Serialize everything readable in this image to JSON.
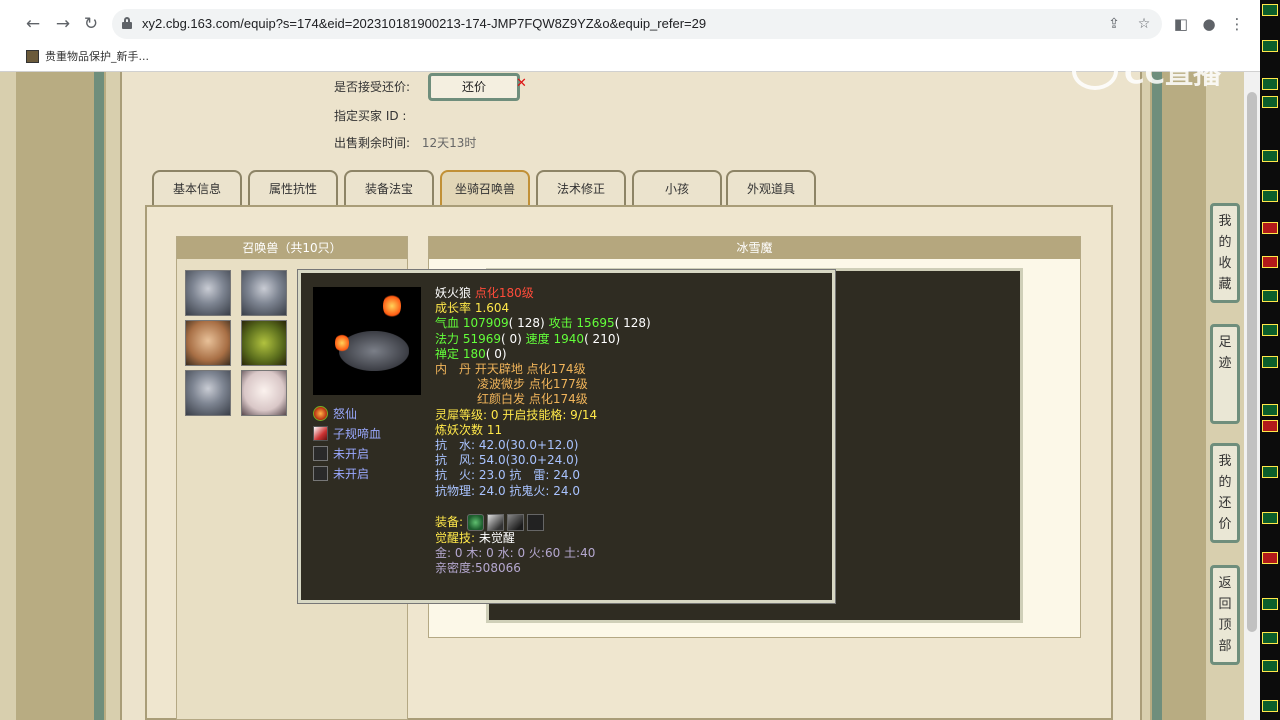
{
  "browser": {
    "url": "xy2.cbg.163.com/equip?s=174&eid=202310181900213-174-JMP7FQW8Z9YZ&o&equip_refer=29",
    "bookmark_label": "贵重物品保护_新手..."
  },
  "watermark": "CC直播",
  "form": {
    "accept_counter_label": "是否接受还价:",
    "counter_button": "还价",
    "buyer_id_label": "指定买家 ID :",
    "time_left_label": "出售剩余时间:",
    "time_left_value": "12天13时"
  },
  "tabs": [
    "基本信息",
    "属性抗性",
    "装备法宝",
    "坐骑召唤兽",
    "法术修正",
    "小孩",
    "外观道具"
  ],
  "pet_list": {
    "title": "召唤兽（共10只）"
  },
  "detail": {
    "title": "冰雪魔"
  },
  "tooltip": {
    "name": "妖火狼",
    "level": "点化180级",
    "growth": "成长率 1.604",
    "qixue_label": "气血",
    "qixue_value": "107909",
    "qixue_extra": "( 128)",
    "gongji_label": "攻击",
    "gongji_value": "15695",
    "gongji_extra": "( 128)",
    "fali_label": "法力",
    "fali_value": "51969",
    "fali_extra": "( 0)",
    "sudu_label": "速度",
    "sudu_value": "1940",
    "sudu_extra": "( 210)",
    "chanding_label": "禅定",
    "chanding_value": "180",
    "chanding_extra": "( 0)",
    "neidan_label": "内　丹",
    "neidan": [
      "开天辟地 点化174级",
      "凌波微步 点化177级",
      "红颜白发 点化174级"
    ],
    "lingxi_label": "灵犀等级:",
    "lingxi_value": "0 开启技能格: 9/14",
    "lianyao": "炼妖次数 11",
    "resist_water": "抗　水: 42.0(30.0+12.0)",
    "resist_wind": "抗　风: 54.0(30.0+24.0)",
    "resist_fire_thunder": "抗　火: 23.0 抗　雷: 24.0",
    "resist_phys_ghost": "抗物理: 24.0 抗鬼火: 24.0",
    "equip_label": "装备:",
    "awaken_label": "觉醒技:",
    "awaken_value": "未觉醒",
    "elements": "金: 0 木: 0 水: 0 火:60 土:40",
    "intimacy": "亲密度:508066",
    "skills": [
      "怒仙",
      "子规啼血",
      "未开启",
      "未开启"
    ]
  },
  "float_nav": [
    {
      "label": "我的收藏"
    },
    {
      "label": "足迹"
    },
    {
      "label": "我的还价"
    },
    {
      "label": "返回顶部"
    }
  ],
  "colors": {
    "tooltip_bg": "#2f2c22",
    "frame_green": "#6f8e7c",
    "tab_active_border": "#c19036",
    "header_tan": "#b5a77e"
  }
}
